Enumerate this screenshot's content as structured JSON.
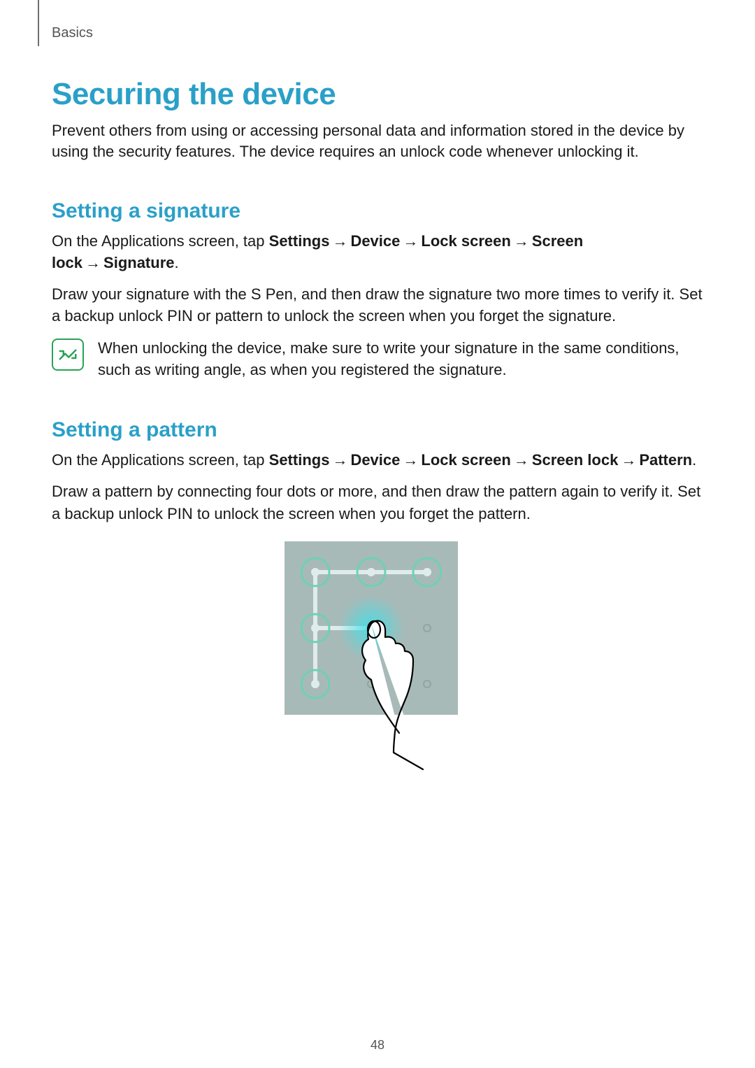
{
  "breadcrumb": "Basics",
  "h1": "Securing the device",
  "intro": "Prevent others from using or accessing personal data and information stored in the device by using the security features. The device requires an unlock code whenever unlocking it.",
  "sig": {
    "heading": "Setting a signature",
    "path_prefix": "On the Applications screen, tap ",
    "path_b1": "Settings",
    "path_b2": "Device",
    "path_b3": "Lock screen",
    "path_b4": "Screen lock",
    "path_b5": "Signature",
    "dot": ".",
    "body2": "Draw your signature with the S Pen, and then draw the signature two more times to verify it. Set a backup unlock PIN or pattern to unlock the screen when you forget the signature.",
    "note": "When unlocking the device, make sure to write your signature in the same conditions, such as writing angle, as when you registered the signature."
  },
  "pat": {
    "heading": "Setting a pattern",
    "path_prefix": "On the Applications screen, tap ",
    "path_b1": "Settings",
    "path_b2": "Device",
    "path_b3": "Lock screen",
    "path_b4": "Screen lock",
    "path_b5": "Pattern",
    "dot": ".",
    "body2": "Draw a pattern by connecting four dots or more, and then draw the pattern again to verify it. Set a backup unlock PIN to unlock the screen when you forget the pattern."
  },
  "arrow": "→",
  "page_number": "48"
}
